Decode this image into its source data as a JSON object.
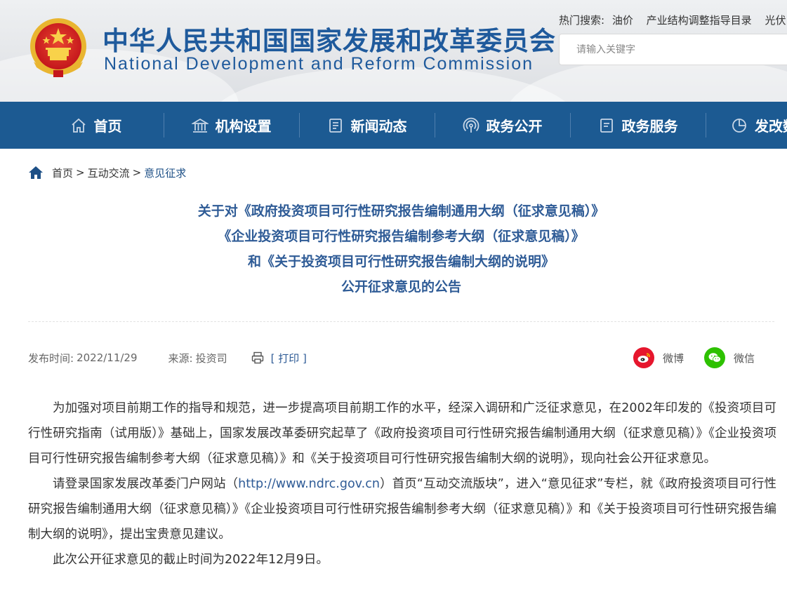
{
  "header": {
    "title_cn": "中华人民共和国国家发展和改革委员会",
    "title_en": "National Development and Reform Commission",
    "hot_search_label": "热门搜索:",
    "hot_search_items": [
      "油价",
      "产业结构调整指导目录",
      "光伏"
    ],
    "search_placeholder": "请输入关键字"
  },
  "nav": {
    "items": [
      {
        "label": "首页",
        "icon": "home-icon"
      },
      {
        "label": "机构设置",
        "icon": "institution-icon"
      },
      {
        "label": "新闻动态",
        "icon": "news-icon"
      },
      {
        "label": "政务公开",
        "icon": "broadcast-icon"
      },
      {
        "label": "政务服务",
        "icon": "service-icon"
      },
      {
        "label": "发改数据",
        "icon": "pie-chart-icon"
      }
    ]
  },
  "breadcrumb": {
    "items": [
      "首页",
      "互动交流",
      "意见征求"
    ],
    "separator": ">"
  },
  "article": {
    "title_lines": [
      "关于对《政府投资项目可行性研究报告编制通用大纲（征求意见稿）》",
      "《企业投资项目可行性研究报告编制参考大纲（征求意见稿）》",
      "和《关于投资项目可行性研究报告编制大纲的说明》",
      "公开征求意见的公告"
    ],
    "publish_label": "发布时间:",
    "publish_date": "2022/11/29",
    "source_label": "来源:",
    "source": "投资司",
    "print_label": "[ 打印 ]",
    "share": {
      "weibo": "微博",
      "wechat": "微信"
    },
    "p1": "为加强对项目前期工作的指导和规范，进一步提高项目前期工作的水平，经深入调研和广泛征求意见，在2002年印发的《投资项目可行性研究指南（试用版）》基础上，国家发展改革委研究起草了《政府投资项目可行性研究报告编制通用大纲（征求意见稿）》《企业投资项目可行性研究报告编制参考大纲（征求意见稿）》和《关于投资项目可行性研究报告编制大纲的说明》，现向社会公开征求意见。",
    "p2_before": "请登录国家发展改革委门户网站（",
    "p2_link": "http://www.ndrc.gov.cn",
    "p2_after": "）首页“互动交流版块”，进入“意见征求”专栏，就《政府投资项目可行性研究报告编制通用大纲（征求意见稿）》《企业投资项目可行性研究报告编制参考大纲（征求意见稿）》和《关于投资项目可行性研究报告编制大纲的说明》，提出宝贵意见建议。",
    "p3": "此次公开征求意见的截止时间为2022年12月9日。"
  },
  "colors": {
    "brand_blue": "#1f5a9c",
    "nav_bg": "#1c5a92",
    "title_blue": "#2e5b96",
    "weibo_red": "#e6162d",
    "wechat_green": "#2dc100"
  }
}
